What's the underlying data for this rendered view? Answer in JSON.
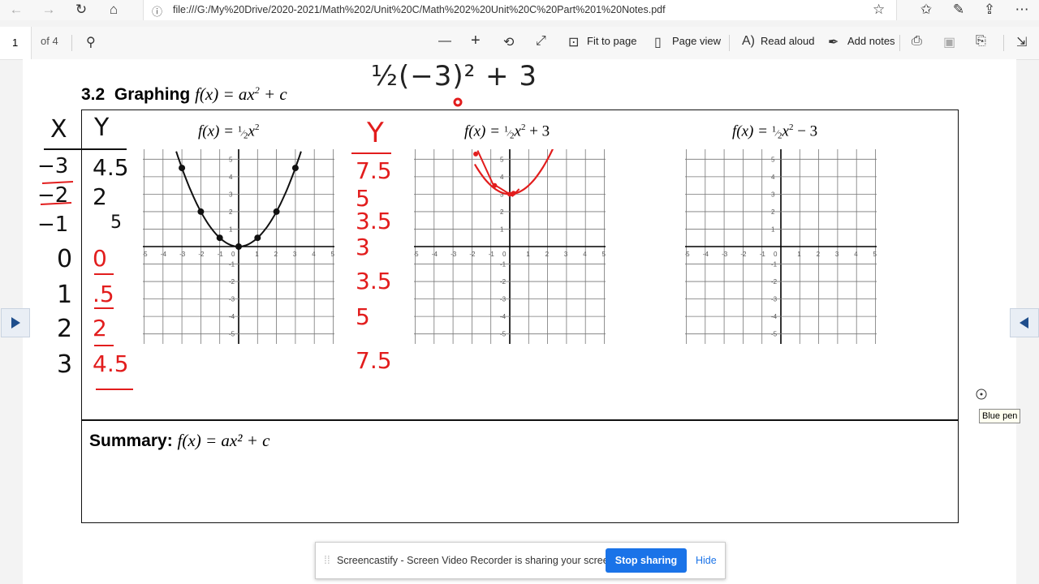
{
  "browser": {
    "url": "file:///G:/My%20Drive/2020-2021/Math%202/Unit%20C/Math%202%20Unit%20C%20Part%201%20Notes.pdf"
  },
  "pdf_toolbar": {
    "page_number": "1",
    "page_count": "of 4",
    "fit_to_page": "Fit to page",
    "page_view": "Page view",
    "read_aloud": "Read aloud",
    "add_notes": "Add notes"
  },
  "document": {
    "section_number": "3.2",
    "heading_word": "Graphing",
    "graphs": [
      {
        "title_lhs": "f(x) = ",
        "title_rhs": "x",
        "title_tail": ""
      },
      {
        "title_lhs": "f(x) = ",
        "title_rhs": "x",
        "title_tail": " + 3"
      },
      {
        "title_lhs": "f(x) = ",
        "title_rhs": "x",
        "title_tail": " − 3"
      }
    ],
    "axis_ticks": [
      "-5",
      "-4",
      "-3",
      "-2",
      "-1",
      "0",
      "1",
      "2",
      "3",
      "4",
      "5"
    ],
    "summary_label": "Summary:",
    "summary_formula": "f(x) = ax² + c"
  },
  "handwriting": {
    "calc": "½(−3)² + 3",
    "x_header": "X",
    "y_header": "Y",
    "x_values": [
      "−3",
      "−2",
      "−1",
      "0",
      "1",
      "2",
      "3"
    ],
    "y_values": [
      "4.5",
      "2",
      "5",
      "0",
      ".5",
      "2",
      "4.5"
    ],
    "y2_header": "Y",
    "y2_values": [
      "7.5",
      "5",
      "3.5",
      "3",
      "3.5",
      "5",
      "7.5"
    ],
    "plotted_points": [
      [
        -3,
        4.5
      ],
      [
        -2,
        2
      ],
      [
        -1,
        0.5
      ],
      [
        0,
        0
      ],
      [
        1,
        0.5
      ],
      [
        2,
        2
      ],
      [
        3,
        4.5
      ]
    ]
  },
  "tooltip": "Blue pen",
  "share_bar": {
    "message": "Screencastify - Screen Video Recorder is sharing your screen.",
    "stop_label": "Stop sharing",
    "hide_label": "Hide"
  },
  "colors": {
    "ink_red": "#e21d1d",
    "accent_blue": "#1a73e8"
  }
}
